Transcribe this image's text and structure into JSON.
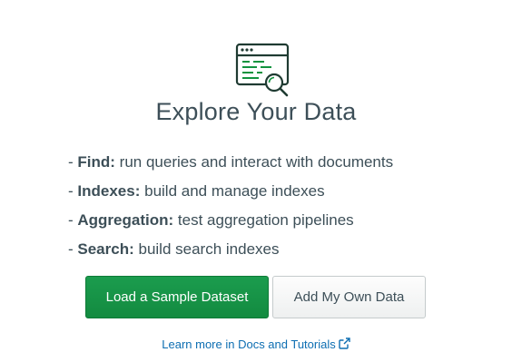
{
  "hero": {
    "icon": "magnifier-over-document-icon",
    "title": "Explore Your Data"
  },
  "features": [
    {
      "term": "Find:",
      "desc": "run queries and interact with documents"
    },
    {
      "term": "Indexes:",
      "desc": "build and manage indexes"
    },
    {
      "term": "Aggregation:",
      "desc": "test aggregation pipelines"
    },
    {
      "term": "Search:",
      "desc": "build search indexes"
    }
  ],
  "actions": {
    "primary_label": "Load a Sample Dataset",
    "secondary_label": "Add My Own Data"
  },
  "docs_link": {
    "label": "Learn more in Docs and Tutorials",
    "icon": "external-link-icon"
  },
  "colors": {
    "primary": "#13933f",
    "text": "#3d4f58",
    "icon_green": "#13933f",
    "icon_dark": "#1f3b32",
    "link": "#0d6eb2"
  }
}
